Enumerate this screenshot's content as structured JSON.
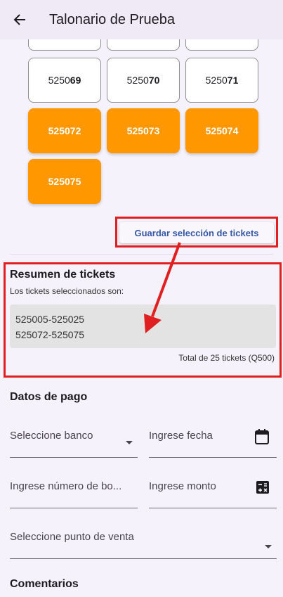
{
  "app_bar": {
    "title": "Talonario de Prueba"
  },
  "tickets": {
    "row_b": [
      {
        "prefix": "5250",
        "suffix": "69"
      },
      {
        "prefix": "5250",
        "suffix": "70"
      },
      {
        "prefix": "5250",
        "suffix": "71"
      }
    ],
    "selected": [
      "525072",
      "525073",
      "525074",
      "525075"
    ]
  },
  "save_button_label": "Guardar selección de tickets",
  "summary": {
    "title": "Resumen de tickets",
    "subtitle": "Los tickets seleccionados son:",
    "ranges": [
      "525005-525025",
      "525072-525075"
    ],
    "total": "Total de 25 tickets (Q500)"
  },
  "payment": {
    "title": "Datos de pago",
    "bank_placeholder": "Seleccione banco",
    "date_placeholder": "Ingrese fecha",
    "voucher_placeholder": "Ingrese número de bo...",
    "amount_placeholder": "Ingrese monto",
    "point_of_sale_placeholder": "Seleccione punto de venta"
  },
  "comments": {
    "title": "Comentarios"
  },
  "colors": {
    "selected_ticket": "#ff9800",
    "annotation": "#e02020",
    "button_text": "#3557a6"
  },
  "icons": [
    "arrow-back-icon",
    "calendar-icon",
    "calculator-icon",
    "dropdown-arrow-icon"
  ]
}
